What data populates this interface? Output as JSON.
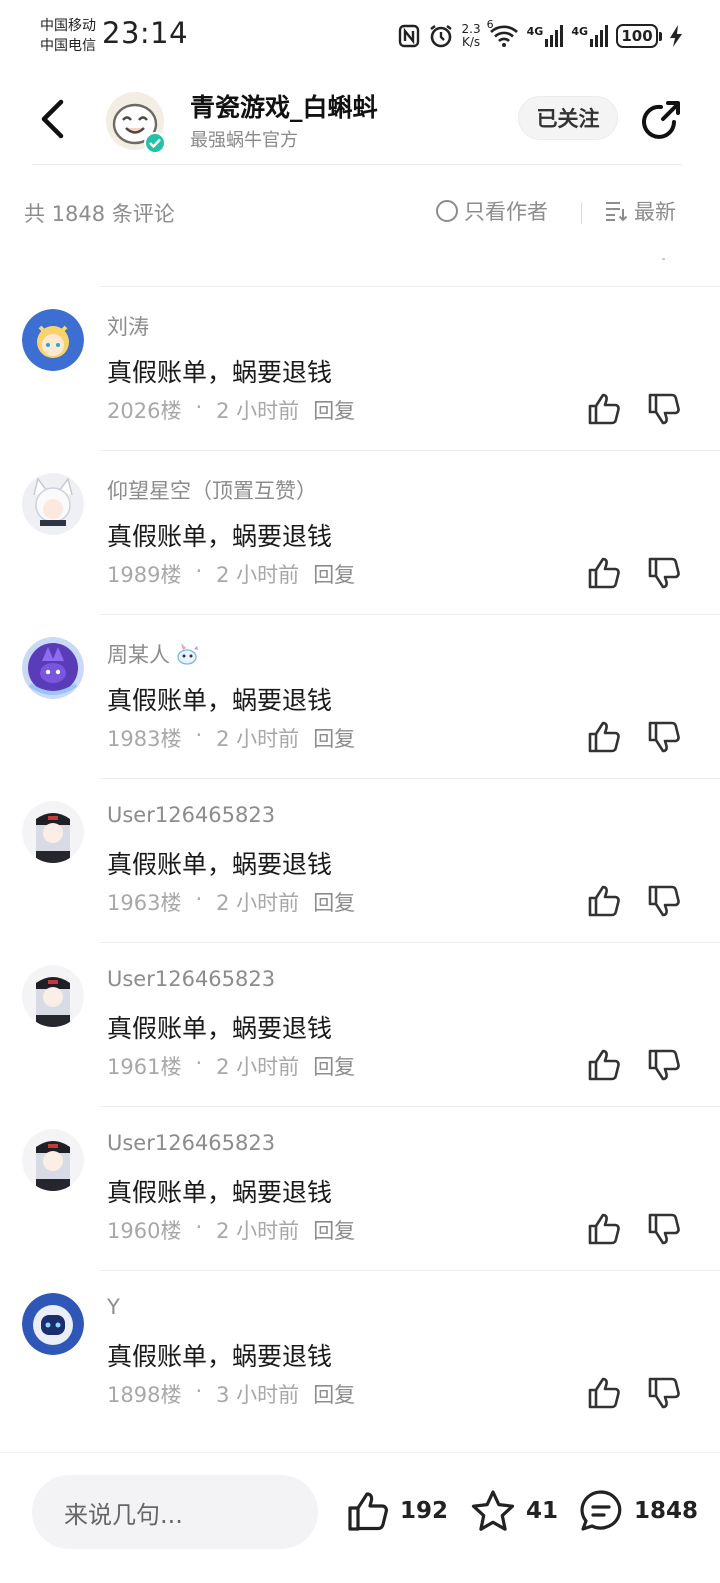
{
  "status_bar": {
    "carrier_1": "中国移动",
    "carrier_2": "中国电信",
    "time": "23:14",
    "net_speed_value": "2.3",
    "net_speed_unit": "K/s",
    "wifi_badge": "6",
    "signal_1": "4G",
    "signal_2": "4G",
    "battery": "100"
  },
  "header": {
    "author_name": "青瓷游戏_白蝌蚪",
    "author_subtitle": "最强蜗牛官方",
    "follow_label": "已关注",
    "verified_color": "#23c2a6"
  },
  "filter": {
    "count_text": "共 1848 条评论",
    "author_only_label": "只看作者",
    "sort_label": "最新"
  },
  "comments": [
    {
      "user": "刘涛",
      "text": "真假账单，蜗要退钱",
      "floor": "2026楼",
      "time": "2 小时前",
      "reply": "回复",
      "avatar": "blonde-girl-avatar",
      "color": "#3c6fd1"
    },
    {
      "user": "仰望星空（顶置互赞）",
      "text": "真假账单，蜗要退钱",
      "floor": "1989楼",
      "time": "2 小时前",
      "reply": "回复",
      "avatar": "white-fox-girl-avatar",
      "color": "#d9d9e3"
    },
    {
      "user": "周某人",
      "text": "真假账单，蜗要退钱",
      "floor": "1983楼",
      "time": "2 小时前",
      "reply": "回复",
      "avatar": "purple-creature-avatar",
      "color": "#7b5bd6"
    },
    {
      "user": "User126465823",
      "text": "真假账单，蜗要退钱",
      "floor": "1963楼",
      "time": "2 小时前",
      "reply": "回复",
      "avatar": "silver-hair-girl-avatar",
      "color": "#2b2b33"
    },
    {
      "user": "User126465823",
      "text": "真假账单，蜗要退钱",
      "floor": "1961楼",
      "time": "2 小时前",
      "reply": "回复",
      "avatar": "silver-hair-girl-avatar",
      "color": "#2b2b33"
    },
    {
      "user": "User126465823",
      "text": "真假账单，蜗要退钱",
      "floor": "1960楼",
      "time": "2 小时前",
      "reply": "回复",
      "avatar": "silver-hair-girl-avatar",
      "color": "#2b2b33"
    },
    {
      "user": "Y",
      "text": "真假账单，蜗要退钱",
      "floor": "1898楼",
      "time": "3 小时前",
      "reply": "回复",
      "avatar": "robot-avatar",
      "color": "#2f57b8"
    }
  ],
  "bottom_bar": {
    "input_placeholder": "来说几句...",
    "likes": "192",
    "favorites": "41",
    "comments": "1848"
  }
}
